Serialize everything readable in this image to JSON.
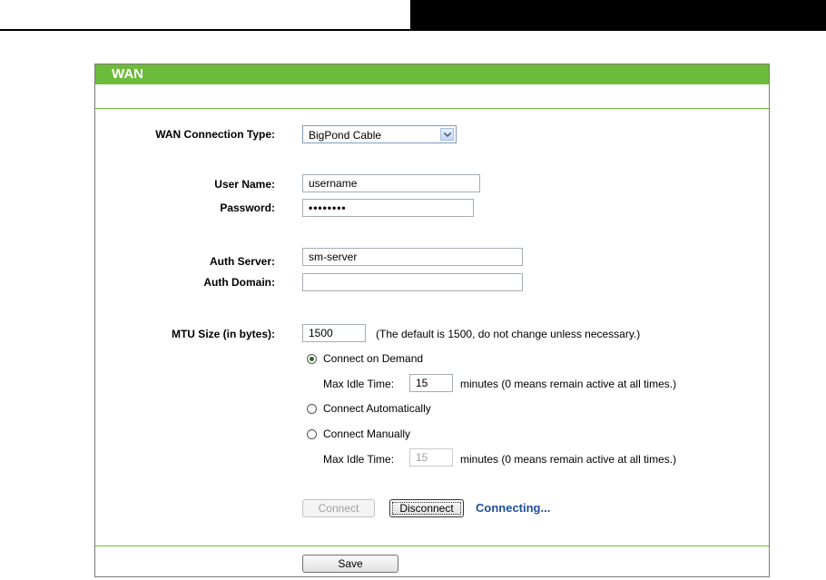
{
  "panel": {
    "title": "WAN"
  },
  "wan_type": {
    "label": "WAN Connection Type:",
    "value": "BigPond Cable"
  },
  "user": {
    "label": "User Name:",
    "value": "username"
  },
  "password": {
    "label": "Password:",
    "value": "••••••••"
  },
  "auth_server": {
    "label": "Auth Server:",
    "value": "sm-server"
  },
  "auth_domain": {
    "label": "Auth Domain:",
    "value": ""
  },
  "mtu": {
    "label": "MTU Size (in bytes):",
    "value": "1500",
    "note": "(The default is 1500, do not change unless necessary.)"
  },
  "mode": {
    "on_demand": {
      "label": "Connect on Demand",
      "selected": true
    },
    "idle1": {
      "label": "Max Idle Time:",
      "value": "15",
      "note": "minutes (0 means remain active at all times.)"
    },
    "automatic": {
      "label": "Connect Automatically",
      "selected": false
    },
    "manual": {
      "label": "Connect Manually",
      "selected": false
    },
    "idle2": {
      "label": "Max Idle Time:",
      "value": "15",
      "note": "minutes (0 means remain active at all times.)"
    }
  },
  "actions": {
    "connect": "Connect",
    "disconnect": "Disconnect",
    "status": "Connecting..."
  },
  "footer": {
    "save": "Save"
  },
  "colors": {
    "header_green": "#6dbb3b",
    "status_blue": "#1f4ea0"
  }
}
